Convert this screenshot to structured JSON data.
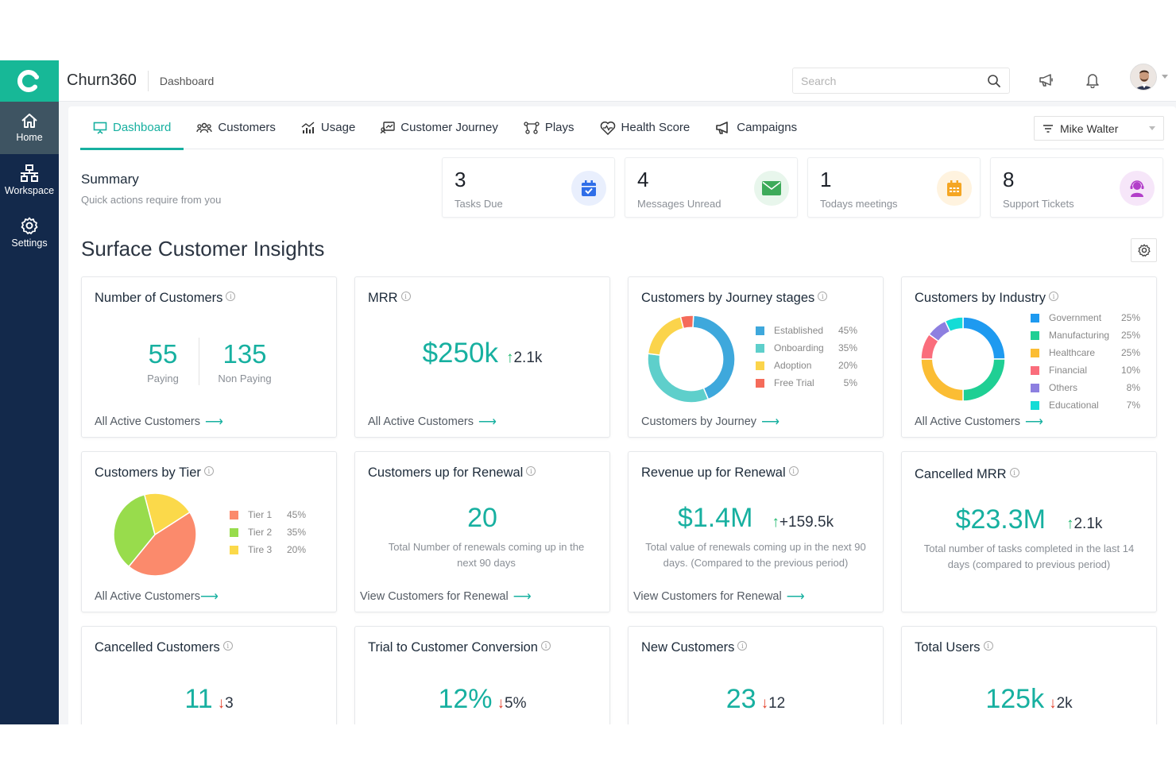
{
  "app": {
    "name": "Churn360",
    "breadcrumb": "Dashboard",
    "logo_letter": "C"
  },
  "sidebar": {
    "items": [
      {
        "label": "Home",
        "icon": "home-icon",
        "active": true
      },
      {
        "label": "Workspace",
        "icon": "workspace-icon",
        "active": false
      },
      {
        "label": "Settings",
        "icon": "gear-icon",
        "active": false
      }
    ]
  },
  "topbar": {
    "search_placeholder": "Search",
    "search_value": ""
  },
  "tabs": [
    {
      "label": "Dashboard",
      "icon": "presentation-icon",
      "active": true
    },
    {
      "label": "Customers",
      "icon": "users-icon",
      "active": false
    },
    {
      "label": "Usage",
      "icon": "usage-chart-icon",
      "active": false
    },
    {
      "label": "Customer Journey",
      "icon": "journey-icon",
      "active": false
    },
    {
      "label": "Plays",
      "icon": "plays-icon",
      "active": false
    },
    {
      "label": "Health Score",
      "icon": "heart-pulse-icon",
      "active": false
    },
    {
      "label": "Campaigns",
      "icon": "megaphone-icon",
      "active": false
    }
  ],
  "user_filter": {
    "selected": "Mike Walter"
  },
  "summary": {
    "title": "Summary",
    "subtitle": "Quick actions require from you"
  },
  "stats": [
    {
      "value": "3",
      "label": "Tasks Due",
      "icon": "calendar-check-icon",
      "color": "#2f6ee8",
      "bg": "#e9effd"
    },
    {
      "value": "4",
      "label": "Messages Unread",
      "icon": "envelope-icon",
      "color": "#3daa5a",
      "bg": "#e8f6ec"
    },
    {
      "value": "1",
      "label": "Todays meetings",
      "icon": "calendar-icon",
      "color": "#f5a623",
      "bg": "#fff3df"
    },
    {
      "value": "8",
      "label": "Support Tickets",
      "icon": "support-agent-icon",
      "color": "#b23fc9",
      "bg": "#f6e6f9"
    }
  ],
  "section_title": "Surface Customer Insights",
  "cards": {
    "number_of_customers": {
      "title": "Number of Customers",
      "paying": "55",
      "paying_label": "Paying",
      "non_paying": "135",
      "non_paying_label": "Non Paying",
      "link": "All Active Customers"
    },
    "mrr": {
      "title": "MRR",
      "value": "$250k",
      "delta": "2.1k",
      "direction": "up",
      "link": "All Active Customers"
    },
    "journey": {
      "title": "Customers by Journey stages",
      "link": "Customers by Journey"
    },
    "industry": {
      "title": "Customers by Industry",
      "link": "All Active Customers"
    },
    "tier": {
      "title": "Customers by Tier",
      "link": "All Active Customers"
    },
    "renewal_customers": {
      "title": "Customers up for Renewal",
      "value": "20",
      "desc": "Total Number of renewals coming up in the next 90 days",
      "link": "View Customers for Renewal"
    },
    "renewal_revenue": {
      "title": "Revenue up for Renewal",
      "value": "$1.4M",
      "delta": "+159.5k",
      "direction": "up",
      "desc": "Total value of renewals coming up in the next 90 days. (Compared to the previous period)",
      "link": "View Customers for Renewal"
    },
    "cancelled_mrr": {
      "title": "Cancelled MRR",
      "value": "$23.3M",
      "delta": "2.1k",
      "direction": "up",
      "desc": "Total number of tasks completed in the last 14 days (compared to previous period)"
    },
    "cancelled_customers": {
      "title": "Cancelled Customers",
      "value": "11",
      "delta": "3",
      "direction": "down"
    },
    "trial_conversion": {
      "title": "Trial to Customer Conversion",
      "value": "12%",
      "delta": "5%",
      "direction": "down"
    },
    "new_customers": {
      "title": "New Customers",
      "value": "23",
      "delta": "12",
      "direction": "down"
    },
    "total_users": {
      "title": "Total Users",
      "value": "125k",
      "delta": "2k",
      "direction": "down"
    }
  },
  "chart_data": [
    {
      "type": "pie",
      "title": "Customers by Journey stages",
      "donut": true,
      "categories": [
        "Established",
        "Onboarding",
        "Adoption",
        "Free Trial"
      ],
      "values": [
        45,
        35,
        20,
        5
      ],
      "labels": [
        "45%",
        "35%",
        "20%",
        "5%"
      ],
      "colors": [
        "#3ea8dc",
        "#5ecfcb",
        "#fbd44b",
        "#f56b5a"
      ]
    },
    {
      "type": "pie",
      "title": "Customers by Industry",
      "donut": true,
      "categories": [
        "Government",
        "Manufacturing",
        "Healthcare",
        "Financial",
        "Others",
        "Educational"
      ],
      "values": [
        25,
        25,
        25,
        10,
        8,
        7
      ],
      "labels": [
        "25%",
        "25%",
        "25%",
        "10%",
        "8%",
        "7%"
      ],
      "colors": [
        "#1e9af0",
        "#1fcf94",
        "#fbbd34",
        "#fa6d7c",
        "#8d7fe0",
        "#14dcd6"
      ]
    },
    {
      "type": "pie",
      "title": "Customers by Tier",
      "donut": false,
      "categories": [
        "Tier 1",
        "Tier 2",
        "Tire 3"
      ],
      "values": [
        45,
        35,
        20
      ],
      "labels": [
        "45%",
        "35%",
        "20%"
      ],
      "colors": [
        "#fb8a6c",
        "#98dc4c",
        "#fbd94a"
      ]
    }
  ]
}
